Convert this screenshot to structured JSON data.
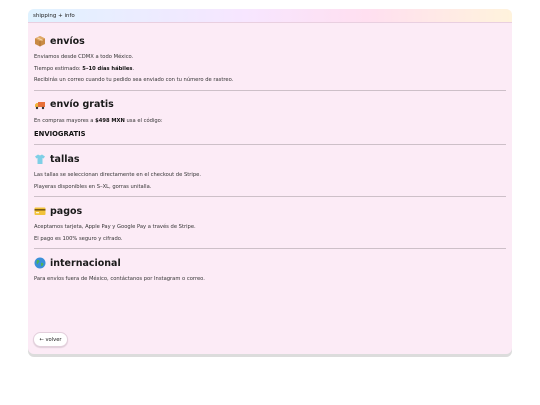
{
  "window": {
    "title": "shipping + info"
  },
  "sections": {
    "envios": {
      "icon": "package-icon",
      "title": "envíos",
      "line1": "Enviamos desde CDMX a todo México.",
      "line2_prefix": "Tiempo estimado: ",
      "line2_bold": "5–10 días hábiles",
      "line2_suffix": ".",
      "line3": "Recibirás un correo cuando tu pedido sea enviado con tu número de rastreo."
    },
    "gratis": {
      "icon": "delivery-truck-icon",
      "title": "envío gratis",
      "line1_prefix": "En compras mayores a ",
      "line1_bold": "$498 MXN",
      "line1_suffix": " usa el código:",
      "code": "ENVIOGRATIS"
    },
    "tallas": {
      "icon": "t-shirt-icon",
      "title": "tallas",
      "line1": "Las tallas se seleccionan directamente en el checkout de Stripe.",
      "line2": "Playeras disponibles en S–XL, gorras unitalla."
    },
    "pagos": {
      "icon": "credit-card-icon",
      "title": "pagos",
      "line1": "Aceptamos tarjeta, Apple Pay y Google Pay a través de Stripe.",
      "line2": "El pago es 100% seguro y cifrado."
    },
    "internacional": {
      "icon": "globe-icon",
      "title": "internacional",
      "line1": "Para envíos fuera de México, contáctanos por Instagram o correo."
    }
  },
  "back_button": {
    "label": "← volver"
  }
}
